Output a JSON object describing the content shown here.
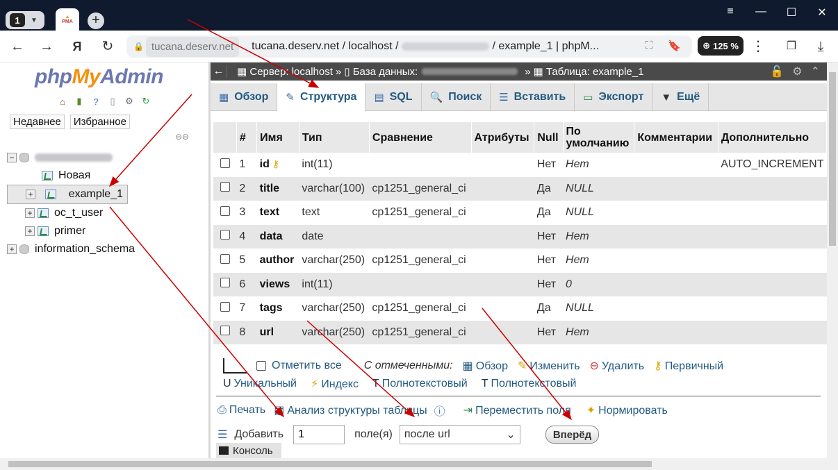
{
  "browser": {
    "tab_count": "1",
    "favicon_text": "PMA",
    "url_host": "tucana.deserv.net",
    "page_title_prefix": "tucana.deserv.net / localhost /",
    "page_title_suffix": "/ example_1 | phpM...",
    "zoom": "125 %"
  },
  "sidebar": {
    "logo_php": "php",
    "logo_my": "My",
    "logo_admin": "Admin",
    "recent_label": "Недавнее",
    "favorites_label": "Избранное",
    "tree": [
      {
        "label": "Новая"
      },
      {
        "label": "example_1"
      },
      {
        "label": "oc_t_user"
      },
      {
        "label": "primer"
      }
    ],
    "info_schema": "information_schema"
  },
  "breadcrumb": {
    "server": "Сервер: localhost",
    "database_label": "База данных:",
    "table": "Таблица: example_1"
  },
  "tabs": [
    {
      "label": "Обзор",
      "icon": "browse-icon"
    },
    {
      "label": "Структура",
      "icon": "structure-icon"
    },
    {
      "label": "SQL",
      "icon": "sql-icon"
    },
    {
      "label": "Поиск",
      "icon": "search-icon"
    },
    {
      "label": "Вставить",
      "icon": "insert-icon"
    },
    {
      "label": "Экспорт",
      "icon": "export-icon"
    },
    {
      "label": "Ещё",
      "icon": "chevron-down-icon"
    }
  ],
  "table": {
    "headers": [
      "#",
      "Имя",
      "Тип",
      "Сравнение",
      "Атрибуты",
      "Null",
      "По умолчанию",
      "Комментарии",
      "Дополнительно"
    ],
    "rows": [
      {
        "n": "1",
        "name": "id",
        "type": "int(11)",
        "collation": "",
        "null": "Нет",
        "default": "Нет",
        "extra": "AUTO_INCREMENT"
      },
      {
        "n": "2",
        "name": "title",
        "type": "varchar(100)",
        "collation": "cp1251_general_ci",
        "null": "Да",
        "default": "NULL",
        "extra": ""
      },
      {
        "n": "3",
        "name": "text",
        "type": "text",
        "collation": "cp1251_general_ci",
        "null": "Да",
        "default": "NULL",
        "extra": ""
      },
      {
        "n": "4",
        "name": "data",
        "type": "date",
        "collation": "",
        "null": "Нет",
        "default": "Нет",
        "extra": ""
      },
      {
        "n": "5",
        "name": "author",
        "type": "varchar(250)",
        "collation": "cp1251_general_ci",
        "null": "Нет",
        "default": "Нет",
        "extra": ""
      },
      {
        "n": "6",
        "name": "views",
        "type": "int(11)",
        "collation": "",
        "null": "Нет",
        "default": "0",
        "extra": ""
      },
      {
        "n": "7",
        "name": "tags",
        "type": "varchar(250)",
        "collation": "cp1251_general_ci",
        "null": "Да",
        "default": "NULL",
        "extra": ""
      },
      {
        "n": "8",
        "name": "url",
        "type": "varchar(250)",
        "collation": "cp1251_general_ci",
        "null": "Нет",
        "default": "Нет",
        "extra": ""
      }
    ]
  },
  "bulk": {
    "check_all": "Отметить все",
    "with_selected": "С отмеченными:",
    "browse": "Обзор",
    "change": "Изменить",
    "drop": "Удалить",
    "primary": "Первичный",
    "unique": "Уникальный",
    "index": "Индекс",
    "fulltext1": "Полнотекстовый",
    "fulltext2": "Полнотекстовый"
  },
  "tools": {
    "print": "Печать",
    "analyze": "Анализ структуры таблицы",
    "move": "Переместить поля",
    "normalize": "Нормировать"
  },
  "add": {
    "label": "Добавить",
    "count": "1",
    "fields": "поле(я)",
    "position": "после url",
    "go": "Вперёд"
  },
  "console": "Консоль"
}
